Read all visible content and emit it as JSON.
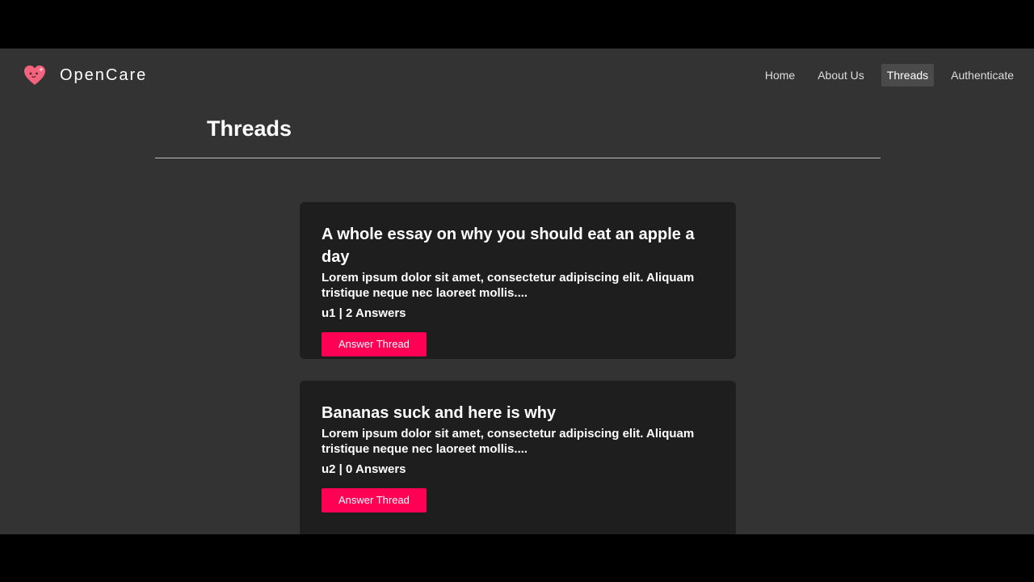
{
  "brand": {
    "name": "OpenCare",
    "logo_icon": "heart-sparkle-icon",
    "logo_color": "#f2647d"
  },
  "nav": {
    "items": [
      {
        "label": "Home",
        "active": false
      },
      {
        "label": "About Us",
        "active": false
      },
      {
        "label": "Threads",
        "active": true
      },
      {
        "label": "Authenticate",
        "active": false
      }
    ]
  },
  "page": {
    "title": "Threads"
  },
  "threads": [
    {
      "title": "A whole essay on why you should eat an apple a day",
      "excerpt": "Lorem ipsum dolor sit amet, consectetur adipiscing elit. Aliquam tristique neque nec laoreet mollis....",
      "meta": "u1 | 2 Answers",
      "button_label": "Answer Thread"
    },
    {
      "title": "Bananas suck and here is why",
      "excerpt": "Lorem ipsum dolor sit amet, consectetur adipiscing elit. Aliquam tristique neque nec laoreet mollis....",
      "meta": "u2 | 0 Answers",
      "button_label": "Answer Thread"
    }
  ],
  "colors": {
    "background": "#333333",
    "card": "#1e1e1e",
    "accent": "#ff0055",
    "nav_active": "#4a4a4a"
  }
}
